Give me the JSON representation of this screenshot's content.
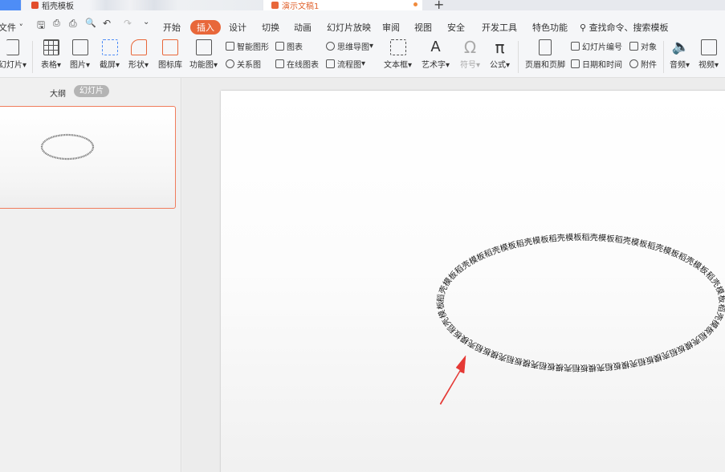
{
  "tabs": {
    "daoke_label": "稻壳模板",
    "doc_label": "演示文稿1",
    "new_tab": "+"
  },
  "menubar": {
    "file": "文件",
    "items": [
      "开始",
      "插入",
      "设计",
      "切换",
      "动画",
      "幻灯片放映",
      "审阅",
      "视图",
      "安全",
      "开发工具",
      "特色功能"
    ],
    "active": "插入",
    "search": "查找命令、搜索模板"
  },
  "ribbon": {
    "slide": "幻灯片",
    "table": "表格",
    "picture": "图片",
    "screenshot": "截屏",
    "shape": "形状",
    "icon_lib": "图标库",
    "func_chart": "功能图",
    "smart_shape": "智能图形",
    "chart": "图表",
    "relation": "关系图",
    "online_chart": "在线图表",
    "mindmap": "思维导图",
    "flowchart": "流程图",
    "textbox": "文本框",
    "wordart": "艺术字",
    "symbol": "符号",
    "formula": "公式",
    "header_footer": "页眉和页脚",
    "slide_number": "幻灯片编号",
    "object": "对象",
    "datetime": "日期和时间",
    "attachment": "附件",
    "audio": "音频",
    "video": "视频"
  },
  "leftpane": {
    "outline": "大纲",
    "slides": "幻灯片"
  },
  "slide": {
    "path_text": "稻壳模板稻壳模板稻壳模板稻壳模板稻壳模板稻壳模板稻壳模板稻壳模板稻壳模板稻壳模板稻壳模板稻壳模板稻壳模板稻壳模板稻壳模板稻壳模板稻壳模板稻壳模板稻壳模板稻壳模板",
    "arrow_color": "#e53935"
  },
  "colors": {
    "accent": "#e8673a",
    "thumb_border": "#f07c5c",
    "home_tab": "#4e8df6"
  }
}
